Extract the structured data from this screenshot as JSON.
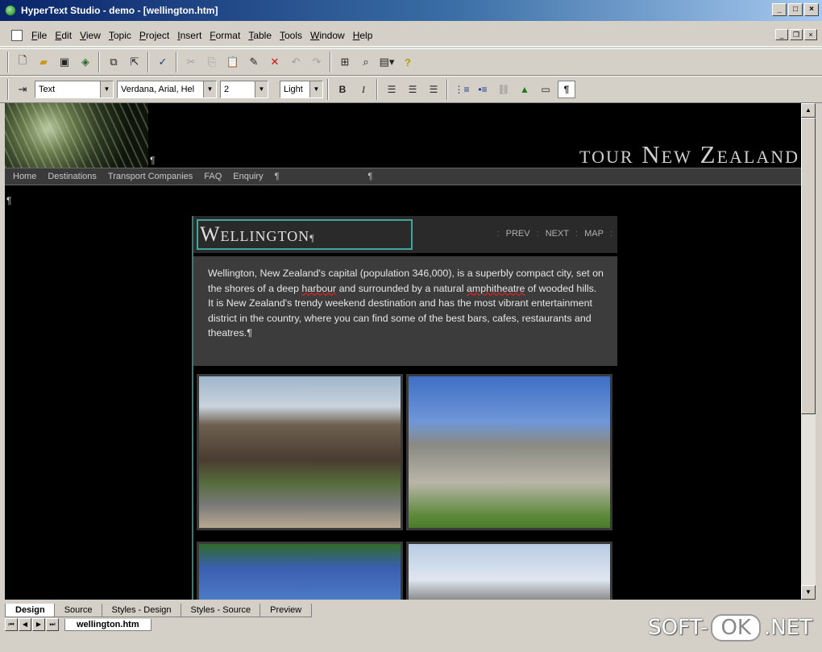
{
  "window": {
    "title": "HyperText Studio - demo - [wellington.htm]"
  },
  "menubar": {
    "items": [
      "File",
      "Edit",
      "View",
      "Topic",
      "Project",
      "Insert",
      "Format",
      "Table",
      "Tools",
      "Window",
      "Help"
    ]
  },
  "format_toolbar": {
    "style_value": "Text",
    "font_value": "Verdana, Arial, Hel",
    "size_value": "2",
    "color_value": "Light"
  },
  "page": {
    "site_title": "tour New Zealand",
    "nav": [
      "Home",
      "Destinations",
      "Transport Companies",
      "FAQ",
      "Enquiry"
    ],
    "pilcrow": "¶",
    "heading": "Wellington",
    "links": {
      "prev": "PREV",
      "next": "NEXT",
      "map": "MAP"
    },
    "paragraph": {
      "part1": "Wellington, New Zealand's capital (population 346,000), is a superbly compact city, set on the shores of a deep ",
      "word1": "harbour",
      "part2": " and surrounded by a natural ",
      "word2": "amphitheatre",
      "part3": " of wooded hills. It is New Zealand's trendy weekend destination and has the most vibrant entertainment district in the country, where you can find some of the best bars, cafes, restaurants and theatres."
    }
  },
  "view_tabs": [
    "Design",
    "Source",
    "Styles - Design",
    "Styles - Source",
    "Preview"
  ],
  "doc_tab": "wellington.htm",
  "watermark": {
    "left": "SOFT-",
    "ok": "OK",
    "right": ".NET"
  }
}
